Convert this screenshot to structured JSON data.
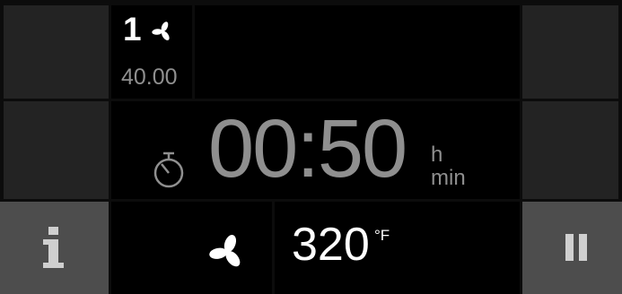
{
  "program": {
    "step_number": "1",
    "step_value": "40.00"
  },
  "timer": {
    "value": "00:50",
    "unit_hours": "h",
    "unit_minutes": "min"
  },
  "temperature": {
    "value": "320",
    "unit": "°F"
  },
  "icons": {
    "step_fan": "fan-icon",
    "timer": "timer-icon",
    "fan": "fan-icon",
    "info": "info-icon",
    "pause": "pause-icon"
  },
  "colors": {
    "side_dark": "#232323",
    "side_light": "#4d4d4d",
    "tile": "#000000",
    "text_white": "#ffffff",
    "text_gray": "#8f8f8f"
  }
}
